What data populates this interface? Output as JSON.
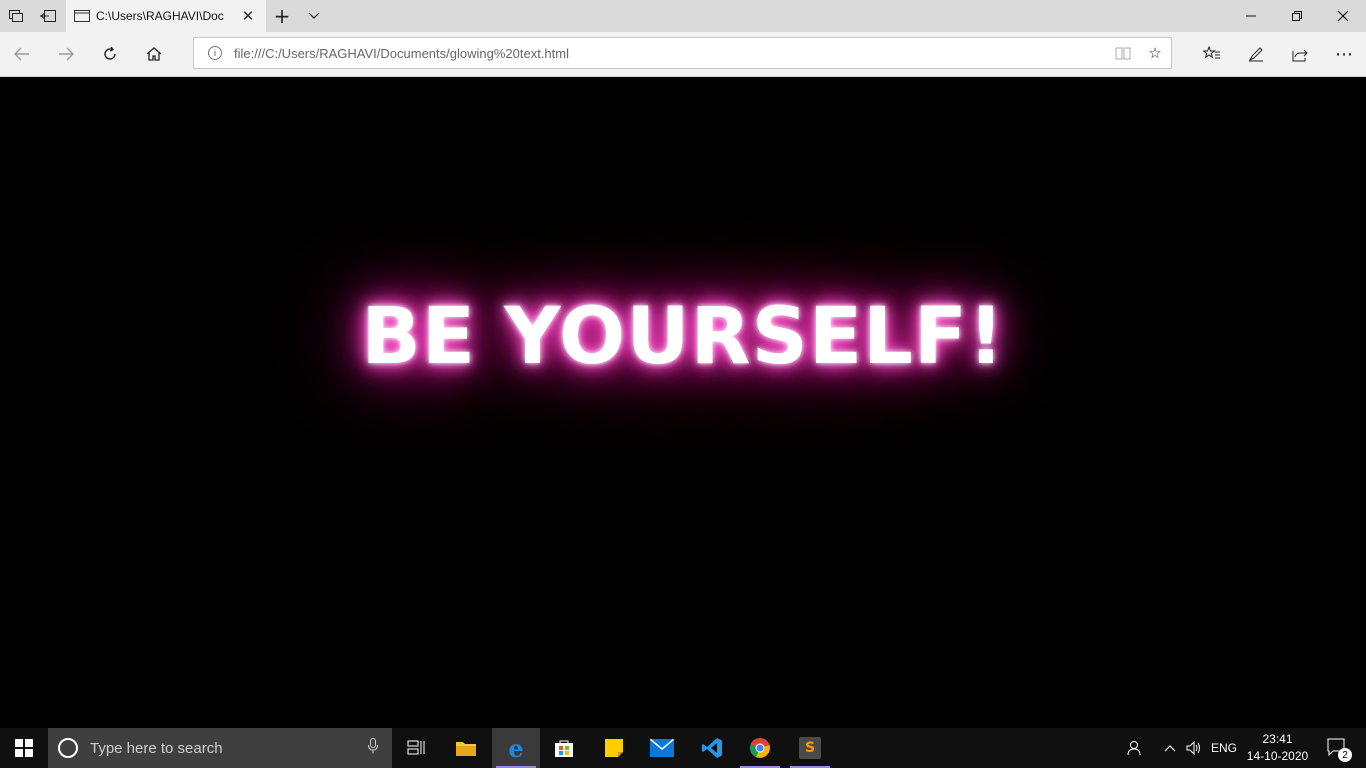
{
  "browser": {
    "tab_title": "C:\\Users\\RAGHAVI\\Doc",
    "address": "file:///C:/Users/RAGHAVI/Documents/glowing%20text.html",
    "new_tab_icon": "+",
    "tab_list_icon": "⌵"
  },
  "page": {
    "glow_text": "BE YOURSELF!",
    "glow_color": "#ff3dc8",
    "background": "#000000"
  },
  "taskbar": {
    "search_placeholder": "Type here to search",
    "language": "ENG",
    "time": "23:41",
    "date": "14-10-2020",
    "notification_count": "2"
  }
}
